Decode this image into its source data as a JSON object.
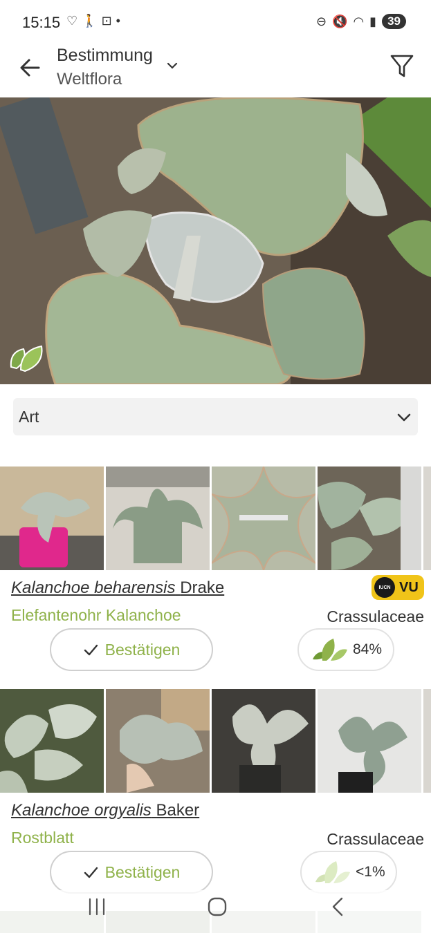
{
  "status_bar": {
    "time": "15:15",
    "left_icons": [
      "snapchat-icon",
      "walking-icon",
      "screenshot-icon",
      "dot-icon"
    ],
    "right_icons": [
      "dnd-icon",
      "mute-icon",
      "wifi-icon",
      "signal-icon"
    ],
    "battery": "39"
  },
  "app_bar": {
    "title": "Bestimmung",
    "subtitle": "Weltflora",
    "back_icon": "arrow-left-icon",
    "dropdown_icon": "chevron-down-icon",
    "filter_icon": "funnel-icon"
  },
  "hero": {
    "badge_icon": "leaves-icon"
  },
  "rank_selector": {
    "value": "Art",
    "icon": "chevron-down-icon"
  },
  "results": [
    {
      "genus_species": "Kalanchoe beharensis",
      "author": "Drake",
      "common_name": "Elefantenohr Kalanchoe",
      "family": "Crassulaceae",
      "confirm_label": "Bestätigen",
      "score": "84%",
      "iucn_label": "IUCN",
      "iucn_code": "VU"
    },
    {
      "genus_species": "Kalanchoe orgyalis",
      "author": "Baker",
      "common_name": "Rostblatt",
      "family": "Crassulaceae",
      "confirm_label": "Bestätigen",
      "score": "<1%"
    }
  ],
  "colors": {
    "accent_green": "#8fb24a",
    "iucn_yellow": "#f0c419",
    "selector_bg": "#f2f2f2"
  },
  "nav_bar": {
    "icons": [
      "recent-apps-icon",
      "home-icon",
      "back-icon"
    ]
  }
}
